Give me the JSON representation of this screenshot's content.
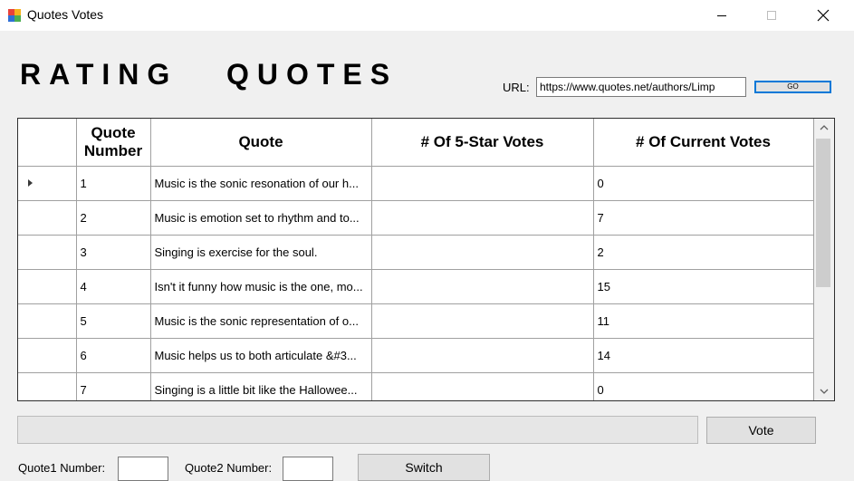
{
  "window": {
    "title": "Quotes Votes",
    "controls": {
      "minimize": "minimize-icon",
      "maximize": "maximize-icon",
      "close": "close-icon"
    }
  },
  "header": {
    "heading": "RATING   QUOTES",
    "url_label": "URL:",
    "url_value": "https://www.quotes.net/authors/Limp",
    "go_label": "GO"
  },
  "grid": {
    "columns": [
      "Quote Number",
      "Quote",
      "# Of 5-Star Votes",
      "# Of Current Votes"
    ],
    "rows": [
      {
        "number": "1",
        "quote": "Music is the sonic resonation of our h...",
        "five_star": "",
        "current": "0",
        "selected": true
      },
      {
        "number": "2",
        "quote": "Music is emotion set to rhythm and to...",
        "five_star": "",
        "current": "7"
      },
      {
        "number": "3",
        "quote": "Singing is exercise for the soul.",
        "five_star": "",
        "current": "2"
      },
      {
        "number": "4",
        "quote": "Isn't it funny how music is the one, mo...",
        "five_star": "",
        "current": "15"
      },
      {
        "number": "5",
        "quote": "Music is the sonic representation of o...",
        "five_star": "",
        "current": "11"
      },
      {
        "number": "6",
        "quote": "Music helps us to both articulate &#3...",
        "five_star": "",
        "current": "14"
      },
      {
        "number": "7",
        "quote": "Singing is a little bit like the Hallowee...",
        "five_star": "",
        "current": "0"
      }
    ]
  },
  "footer": {
    "vote_label": "Vote",
    "quote1_label": "Quote1 Number:",
    "quote1_value": "",
    "quote2_label": "Quote2 Number:",
    "quote2_value": "",
    "switch_label": "Switch"
  },
  "colors": {
    "accent": "#0078d7",
    "window_bg": "#f0f0f0",
    "grid_bg": "#ababab"
  }
}
